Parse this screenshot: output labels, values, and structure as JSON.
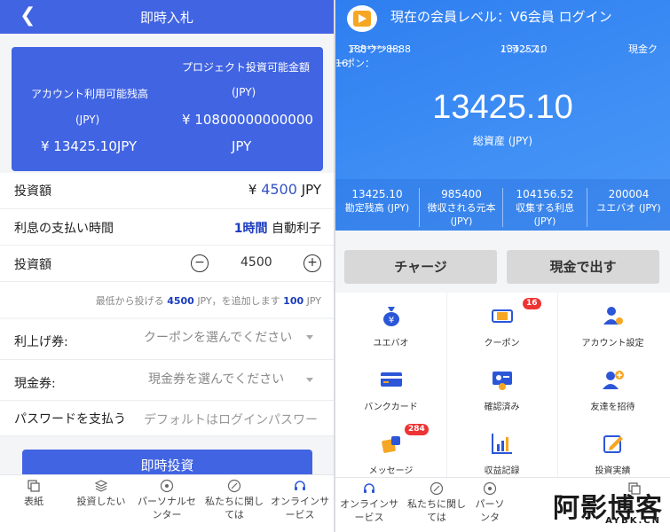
{
  "left": {
    "header": {
      "back_glyph": "❮",
      "title": "即時入札"
    },
    "card": {
      "project_label": "プロジェクト投資可能金額",
      "project_unit_label": "(JPY)",
      "project_amount": "¥ 10800000000000",
      "project_currency": "JPY",
      "account_label": "アカウント利用可能残高",
      "account_unit_label": "(JPY)",
      "account_amount": "¥ 13425.10JPY"
    },
    "invest_amount": {
      "label": "投資額",
      "prefix": "¥",
      "value": "4500",
      "unit": "JPY"
    },
    "interest": {
      "label": "利息の支払い時間",
      "value": "1時間",
      "suffix": "自動利子"
    },
    "stepper": {
      "label": "投資額",
      "minus": "−",
      "plus": "+",
      "value": "4500"
    },
    "hint": {
      "pre": "最低から投げる",
      "min": "4500",
      "mid": "JPY，を追加します",
      "step": "100",
      "post": "JPY"
    },
    "coupon": {
      "label": "利上げ券:",
      "placeholder": "クーポンを選んでください"
    },
    "cash_ticket": {
      "label": "現金券:",
      "placeholder": "現金券を選んでください"
    },
    "password": {
      "label": "パスワードを支払う",
      "placeholder": "デフォルトはログインパスワー"
    },
    "submit_label": "即時投資",
    "tabs": [
      {
        "line1": "表紙",
        "line2": ""
      },
      {
        "line1": "投資したい",
        "line2": ""
      },
      {
        "line1": "パーソナルセ",
        "line2": "ンター"
      },
      {
        "line1": "私たちに関し",
        "line2": "ては"
      },
      {
        "line1": "オンラインサ",
        "line2": "ービス"
      }
    ]
  },
  "right": {
    "title": "現在の会員レベル：V6会員 ログイン",
    "account_label": "アカウント：",
    "account_value": "188****8888",
    "balance_label": "バランス：",
    "balance_value": "13425.10",
    "coupon_label_a": "現金ク",
    "coupon_label_b": "ーポン：",
    "coupon_value": "16",
    "total_value": "13425.10",
    "total_label": "総資産 (JPY)",
    "stats": [
      {
        "value": "13425.10",
        "line1": "勘定残高 (JPY)",
        "line2": ""
      },
      {
        "value": "985400",
        "line1": "徴収される元本",
        "line2": "(JPY)"
      },
      {
        "value": "104156.52",
        "line1": "収集する利息",
        "line2": "(JPY)"
      },
      {
        "value": "200004",
        "line1": "ユエバオ (JPY)",
        "line2": ""
      }
    ],
    "charge_label": "チャージ",
    "withdraw_label": "現金で出す",
    "grid": [
      {
        "label": "ユエバオ",
        "badge": ""
      },
      {
        "label": "クーポン",
        "badge": "16"
      },
      {
        "label": "アカウント設定",
        "badge": ""
      },
      {
        "label": "バンクカード",
        "badge": ""
      },
      {
        "label": "確認済み",
        "badge": ""
      },
      {
        "label": "友達を招待",
        "badge": ""
      },
      {
        "label": "メッセージ",
        "badge": "284"
      },
      {
        "label": "収益記録",
        "badge": ""
      },
      {
        "label": "投資実績",
        "badge": ""
      }
    ],
    "tabs": [
      {
        "line1": "オンラインサ",
        "line2": "ービス"
      },
      {
        "line1": "私たちに関し",
        "line2": "ては"
      },
      {
        "line1": "パーソ",
        "line2": "ンタ"
      },
      {
        "line1": "",
        "line2": ""
      }
    ],
    "watermark_main": "阿影博客",
    "watermark_sub": "AYBK.CN"
  },
  "colors": {
    "primary_blue": "#4164e2",
    "sky_blue": "#3f8ff5",
    "badge_red": "#e33333",
    "accent_orange": "#f5a623"
  }
}
